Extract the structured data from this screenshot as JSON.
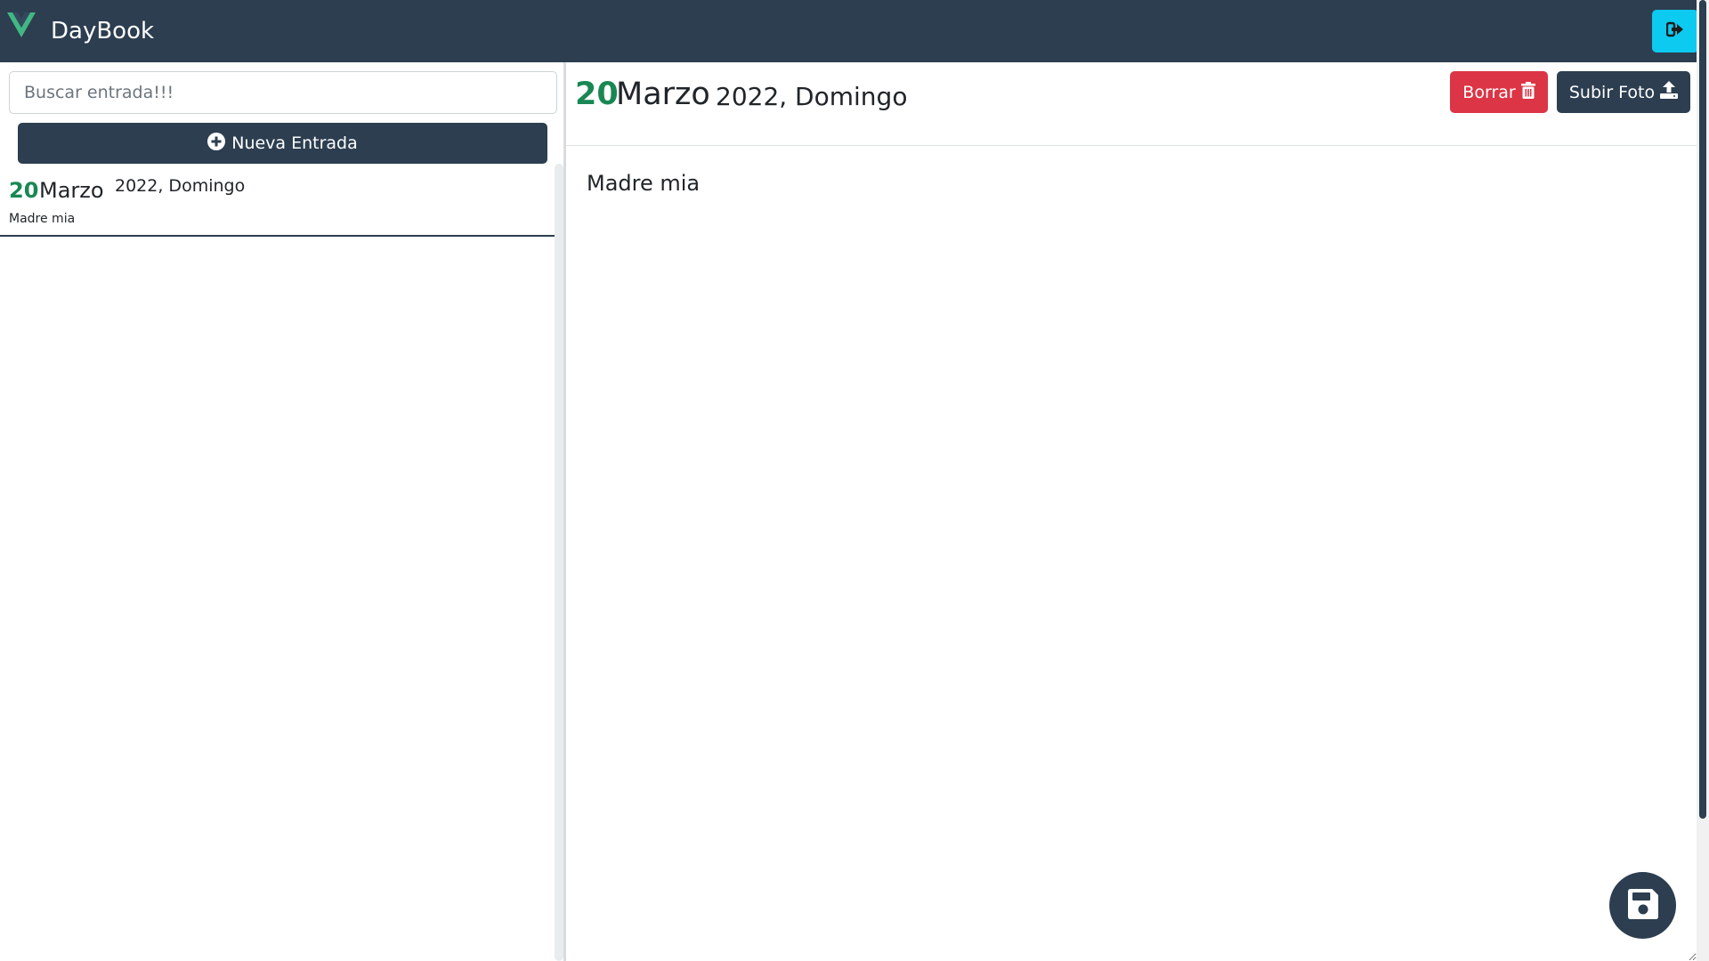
{
  "app": {
    "title": "DayBook"
  },
  "icons": {
    "logo": "vue-logo-icon",
    "logout": "logout-icon",
    "new_entry": "plus-circle-icon",
    "delete": "trash-icon",
    "upload": "upload-icon",
    "save": "save-icon"
  },
  "colors": {
    "navbar": "#2c3e50",
    "accent_green": "#198754",
    "logout_button": "#0dcaf0",
    "delete_button": "#dc3545"
  },
  "sidebar": {
    "search_placeholder": "Buscar entrada!!!",
    "new_entry_label": "Nueva Entrada",
    "entries": [
      {
        "day": "20",
        "month": "Marzo",
        "year_day": "2022, Domingo",
        "text": "Madre mia"
      }
    ]
  },
  "main": {
    "day": "20",
    "month": "Marzo",
    "year_day": "2022, Domingo",
    "delete_label": "Borrar",
    "upload_label": "Subir Foto",
    "entry_text": "Madre mia"
  }
}
